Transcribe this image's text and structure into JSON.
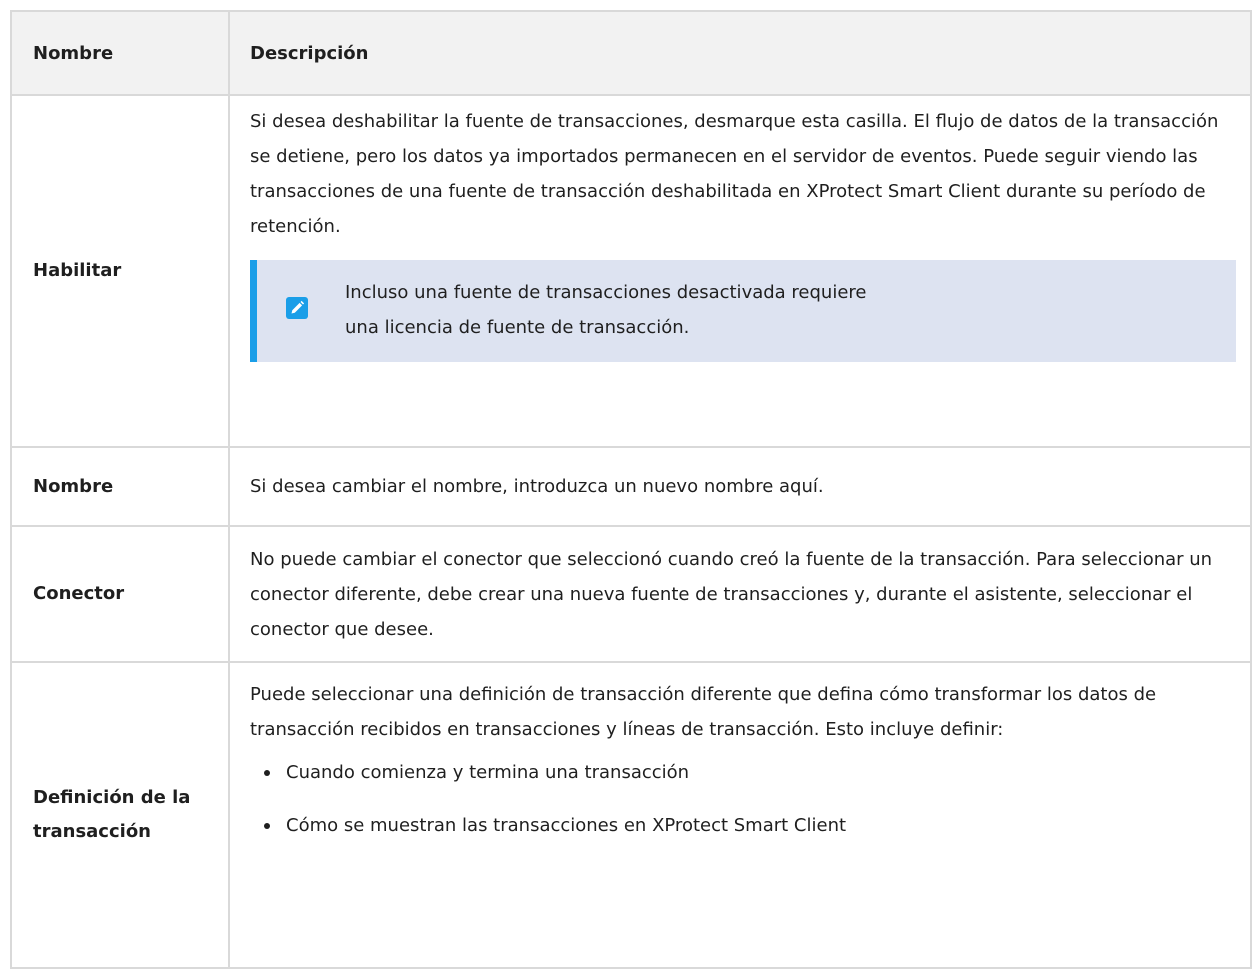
{
  "table": {
    "headers": {
      "name": "Nombre",
      "description": "Descripción"
    },
    "rows": [
      {
        "name": "Habilitar",
        "description": "Si desea deshabilitar la fuente de transacciones, desmarque esta casilla. El flujo de datos de la transacción se detiene, pero los datos ya importados permanecen en el servidor de eventos. Puede seguir viendo las transacciones de una fuente de transacción deshabilitada en XProtect Smart Client durante su período de retención.",
        "note": "Incluso una fuente de transacciones desactivada requiere una licencia de fuente de transacción.",
        "note_icon": "pencil-icon"
      },
      {
        "name": "Nombre",
        "description": "Si desea cambiar el nombre, introduzca un nuevo nombre aquí."
      },
      {
        "name": "Conector",
        "description": "No puede cambiar el conector que seleccionó cuando creó la fuente de la transacción. Para seleccionar un conector diferente, debe crear una nueva fuente de transacciones y, durante el asistente, seleccionar el conector que desee."
      },
      {
        "name": "Definición de la transacción",
        "description": "Puede seleccionar una definición de transacción diferente que defina cómo transformar los datos de transacción recibidos en transacciones y líneas de transacción. Esto incluye definir:",
        "bullets": [
          "Cuando comienza y termina una transacción",
          "Cómo se muestran las transacciones en XProtect Smart Client"
        ]
      }
    ]
  },
  "colors": {
    "header_bg": "#f2f2f2",
    "border": "#d9d9d9",
    "note_bg": "#dde3f1",
    "accent": "#1a9ee8"
  }
}
